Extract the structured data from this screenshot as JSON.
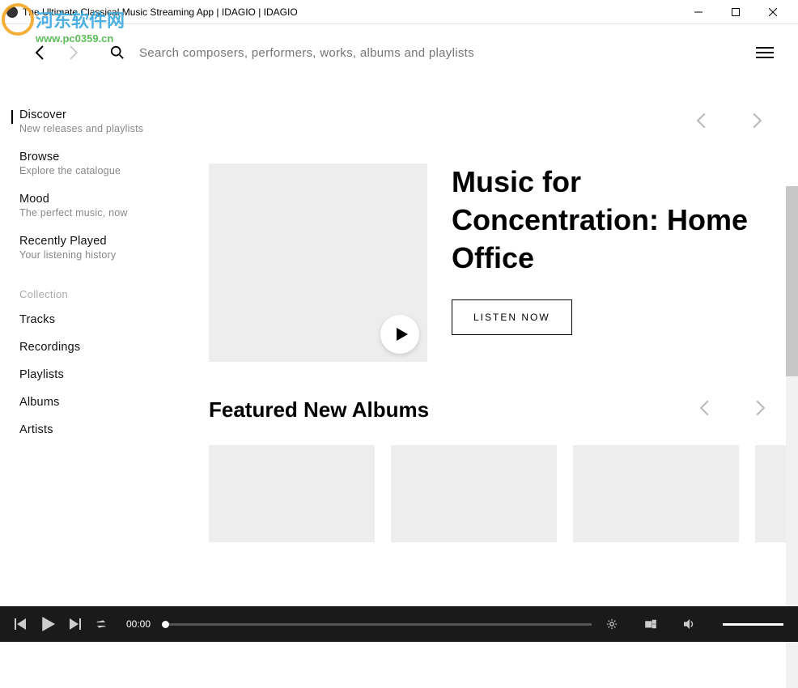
{
  "window": {
    "title": "The Ultimate Classical Music Streaming App | IDAGIO | IDAGIO"
  },
  "watermark": {
    "text": "河东软件网",
    "url": "www.pc0359.cn"
  },
  "search": {
    "placeholder": "Search composers, performers, works, albums and playlists"
  },
  "sidebar": {
    "items": [
      {
        "title": "Discover",
        "sub": "New releases and playlists",
        "active": true
      },
      {
        "title": "Browse",
        "sub": "Explore the catalogue"
      },
      {
        "title": "Mood",
        "sub": "The perfect music, now"
      },
      {
        "title": "Recently Played",
        "sub": "Your listening history"
      }
    ],
    "collection_label": "Collection",
    "collection": [
      "Tracks",
      "Recordings",
      "Playlists",
      "Albums",
      "Artists"
    ]
  },
  "hero": {
    "title": "Music for Concentration: Home Office",
    "cta": "LISTEN NOW"
  },
  "section": {
    "title": "Featured New Albums"
  },
  "player": {
    "time": "00:00"
  }
}
